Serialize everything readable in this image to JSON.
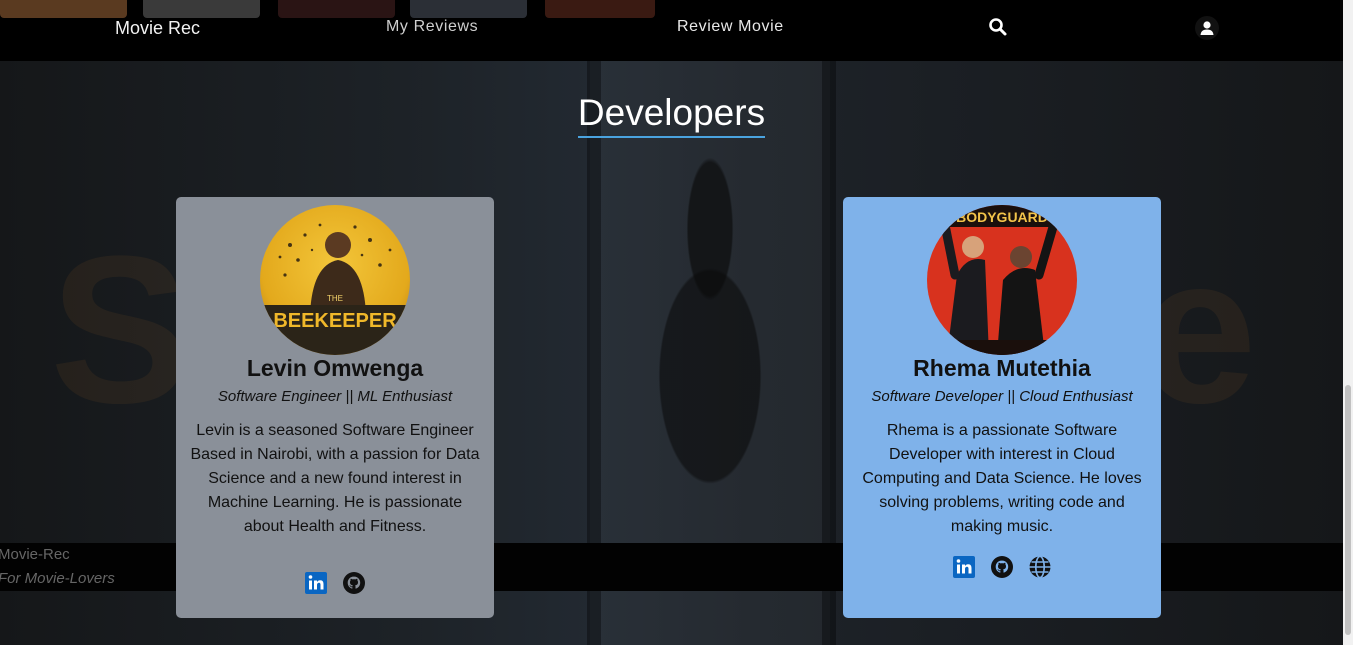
{
  "nav": {
    "brand": "Movie Rec",
    "items": [
      {
        "label": "My Reviews"
      },
      {
        "label": "Review Movie"
      }
    ],
    "search_icon": "search-icon",
    "user_icon": "user-icon"
  },
  "main": {
    "heading": "Developers"
  },
  "developers": [
    {
      "name": "Levin Omwenga",
      "role": "Software Engineer || ML Enthusiast",
      "bio": "Levin is a seasoned Software Engineer Based in Nairobi, with a passion for Data Science and a new found interest in Machine Learning. He is passionate about Health and Fitness.",
      "avatar_caption": "THE BEEKEEPER",
      "card_color": "#8a9099",
      "links": [
        "linkedin-icon",
        "github-icon"
      ]
    },
    {
      "name": "Rhema Mutethia",
      "role": "Software Developer || Cloud Enthusiast",
      "bio": "Rhema is a passionate Software Developer with interest in Cloud Computing and Data Science. He loves solving problems, writing code and making music.",
      "avatar_caption": "BODYGUARD",
      "card_color": "#7fb2ea",
      "links": [
        "linkedin-icon",
        "github-icon",
        "globe-icon"
      ]
    }
  ],
  "footer": {
    "title": "Movie-Rec",
    "tagline": "For Movie-Lovers"
  },
  "colors": {
    "accent_underline": "#4aa3df",
    "linkedin": "#0a66c2"
  }
}
